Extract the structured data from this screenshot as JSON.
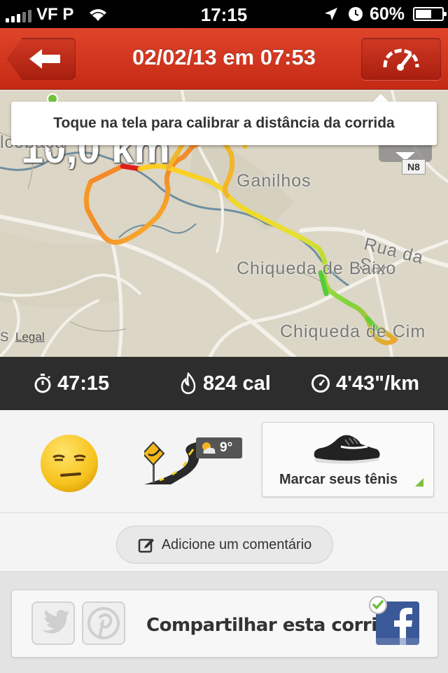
{
  "status_bar": {
    "carrier": "VF P",
    "time": "17:15",
    "battery": "60%",
    "battery_level": 0.6
  },
  "nav": {
    "title": "02/02/13 em 07:53"
  },
  "map": {
    "distance_display": "10,0 km",
    "tooltip": "Toque na tela para calibrar a distância da corrida",
    "labels": {
      "ganilhos": "Ganilhos",
      "rua": "Rua da Sar",
      "chiqueda_baixo": "Chiqueda de Baixo",
      "chiqueda_cima": "Chiqueda de Cim",
      "alcobaca": "lcobaça",
      "s": "s"
    },
    "road_shield": "N8",
    "legal": "Legal"
  },
  "stats": {
    "duration": "47:15",
    "calories": "824 cal",
    "pace": "4'43\"/km"
  },
  "details": {
    "temperature": "9°",
    "shoe_label": "Marcar seus tênis",
    "comment_label": "Adicione um comentário"
  },
  "share": {
    "label": "Compartilhar esta corrida"
  },
  "icons": {
    "back": "back-arrow-icon",
    "speedometer": "speedometer-icon",
    "stopwatch": "stopwatch-icon",
    "flame": "flame-icon",
    "pace": "pace-gauge-icon",
    "mood": "emoji-unamused-icon",
    "terrain": "road-terrain-icon",
    "weather": "partly-cloudy-icon",
    "shoe": "shoe-icon",
    "edit": "edit-icon",
    "twitter": "twitter-icon",
    "pinterest": "pinterest-icon",
    "facebook": "facebook-icon"
  },
  "colors": {
    "nav_red": "#d3371f",
    "stats_bg": "#2d2d2d",
    "facebook_blue": "#3b5998"
  }
}
